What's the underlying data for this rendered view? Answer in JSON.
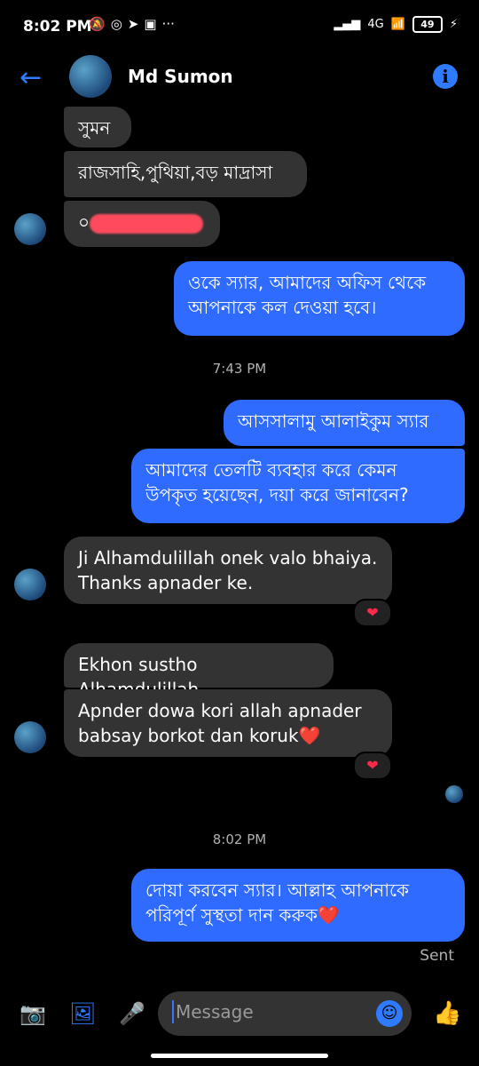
{
  "status_bar": {
    "time": "8:02 PM",
    "left_icons": [
      "mute-icon",
      "whatsapp-icon",
      "telegram-icon",
      "app-icon",
      "more-icon"
    ],
    "network": "4G",
    "battery": "49"
  },
  "header": {
    "contact_name": "Md Sumon"
  },
  "messages": [
    {
      "side": "in",
      "text": "সুমন"
    },
    {
      "side": "in",
      "text": "রাজসাহি,পুথিয়া,বড় মাদ্রাসা"
    },
    {
      "side": "in",
      "text": "০"
    },
    {
      "side": "out",
      "text": "ওকে স্যার, আমাদের অফিস থেকে আপনাকে কল দেওয়া হবে।"
    },
    {
      "side": "out",
      "text": "আসসালামু আলাইকুম স্যার"
    },
    {
      "side": "out",
      "text": "আমাদের তেলটি ব্যবহার করে কেমন উপকৃত হয়েছেন, দয়া করে জানাবেন?"
    },
    {
      "side": "in",
      "text": "Ji Alhamdulillah onek valo bhaiya. Thanks apnader ke."
    },
    {
      "side": "in",
      "text": "Ekhon sustho Alhamdulillah"
    },
    {
      "side": "in",
      "text": "Apnder dowa kori allah apnader babsay borkot dan koruk❤️"
    },
    {
      "side": "out",
      "text": "দোয়া করবেন স্যার। আল্লাহ আপনাকে পরিপূর্ণ সুস্থতা দান করুক❤️"
    }
  ],
  "timestamps": [
    "7:43 PM",
    "8:02 PM"
  ],
  "reactions": [
    "❤",
    "❤"
  ],
  "sent_label": "Sent",
  "composer": {
    "placeholder": "Message"
  },
  "colors": {
    "accent": "#2f7bff",
    "outgoing_bubble": "#2f6bff",
    "incoming_bubble": "#333333",
    "background": "#000000"
  }
}
